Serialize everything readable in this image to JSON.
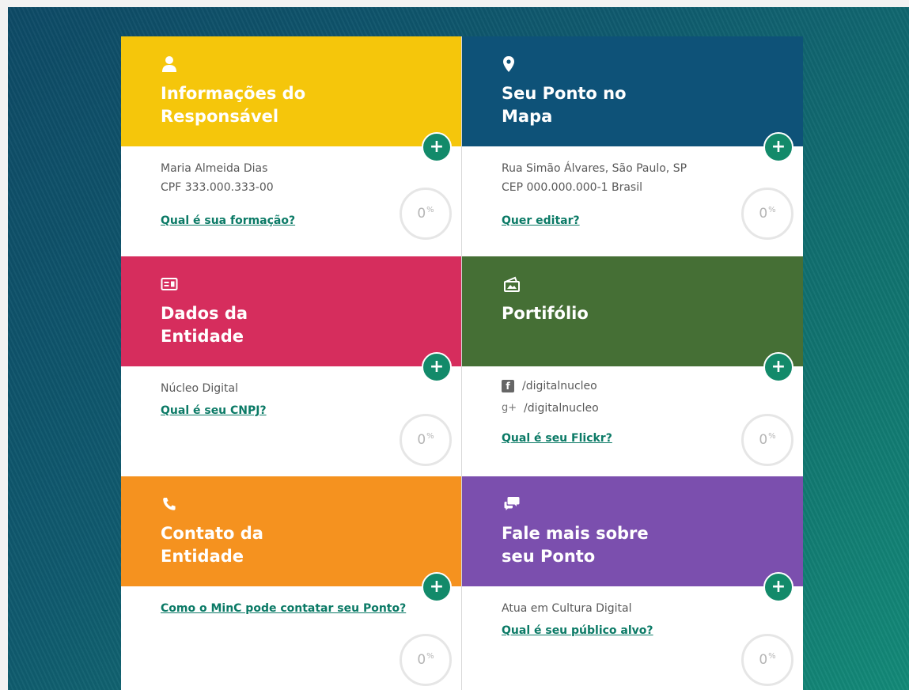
{
  "cards": [
    {
      "title": "Informações do\nResponsável",
      "icon": "person-icon",
      "color": "#f5c60b",
      "lines": [
        "Maria Almeida Dias",
        "CPF 333.000.333-00"
      ],
      "link": "Qual é sua formação?",
      "progress_value": "0",
      "progress_symbol": "%"
    },
    {
      "title": "Seu Ponto no\nMapa",
      "icon": "map-pin-icon",
      "color": "#0e5278",
      "lines": [
        "Rua Simão Álvares, São Paulo, SP",
        "CEP 000.000.000-1 Brasil"
      ],
      "link": "Quer editar?",
      "progress_value": "0",
      "progress_symbol": "%"
    },
    {
      "title": "Dados da\nEntidade",
      "icon": "id-card-icon",
      "color": "#d62d5d",
      "lines": [
        "Núcleo Digital"
      ],
      "link": "Qual é seu CNPJ?",
      "progress_value": "0",
      "progress_symbol": "%"
    },
    {
      "title": "Portifólio",
      "icon": "portfolio-icon",
      "color": "#456f35",
      "social": [
        {
          "icon": "facebook-icon",
          "glyph": "f",
          "text": "/digitalnucleo"
        },
        {
          "icon": "google-plus-icon",
          "glyph": "g+",
          "text": "/digitalnucleo"
        }
      ],
      "link": "Qual é seu Flickr?",
      "progress_value": "0",
      "progress_symbol": "%"
    },
    {
      "title": "Contato da\nEntidade",
      "icon": "phone-icon",
      "color": "#f5921f",
      "lines": [],
      "link": "Como o MinC pode contatar seu Ponto?",
      "progress_value": "0",
      "progress_symbol": "%"
    },
    {
      "title": "Fale mais sobre\nseu Ponto",
      "icon": "chat-bubbles-icon",
      "color": "#7b4fae",
      "lines": [
        "Atua em Cultura Digital"
      ],
      "link": "Qual é seu público alvo?",
      "progress_value": "0",
      "progress_symbol": "%"
    }
  ],
  "add_button_label": "+"
}
